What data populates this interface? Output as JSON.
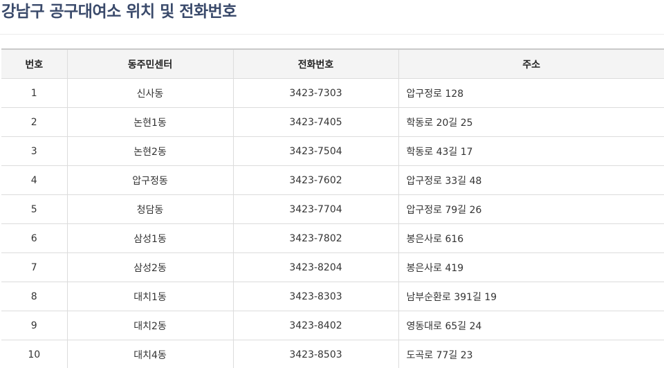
{
  "page": {
    "title": "강남구 공구대여소 위치 및 전화번호"
  },
  "table": {
    "headers": [
      "번호",
      "동주민센터",
      "전화번호",
      "주소"
    ],
    "rows": [
      {
        "no": "1",
        "center": "신사동",
        "phone": "3423-7303",
        "address": "압구정로 128"
      },
      {
        "no": "2",
        "center": "논현1동",
        "phone": "3423-7405",
        "address": "학동로 20길 25"
      },
      {
        "no": "3",
        "center": "논현2동",
        "phone": "3423-7504",
        "address": "학동로 43길 17"
      },
      {
        "no": "4",
        "center": "압구정동",
        "phone": "3423-7602",
        "address": "압구정로 33길 48"
      },
      {
        "no": "5",
        "center": "청담동",
        "phone": "3423-7704",
        "address": "압구정로 79길 26"
      },
      {
        "no": "6",
        "center": "삼성1동",
        "phone": "3423-7802",
        "address": "봉은사로 616"
      },
      {
        "no": "7",
        "center": "삼성2동",
        "phone": "3423-8204",
        "address": "봉은사로 419"
      },
      {
        "no": "8",
        "center": "대치1동",
        "phone": "3423-8303",
        "address": "남부순환로 391길 19"
      },
      {
        "no": "9",
        "center": "대치2동",
        "phone": "3423-8402",
        "address": "영동대로 65길 24"
      },
      {
        "no": "10",
        "center": "대치4동",
        "phone": "3423-8503",
        "address": "도곡로 77길 23"
      }
    ]
  },
  "colors": {
    "title": "#3a4a6b",
    "header_bg": "#f4f4f4",
    "border": "#dcdcdc",
    "text": "#333333"
  }
}
